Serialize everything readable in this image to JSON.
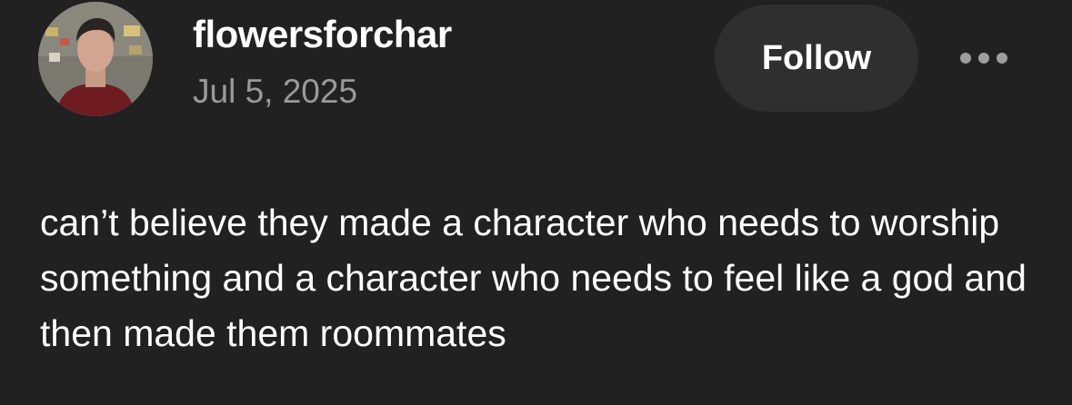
{
  "post": {
    "author": {
      "username": "flowersforchar",
      "avatar_alt": "avatar"
    },
    "date": "Jul 5, 2025",
    "follow_label": "Follow",
    "more_icon": "more-horizontal-icon",
    "text": "can’t believe they made a character who needs to worship something and a character who needs to feel like a god and then made them roommates"
  },
  "colors": {
    "background": "#212121",
    "follow_button_bg": "#2f2f2f",
    "date_text": "#9a9a9a",
    "text": "#ffffff"
  }
}
